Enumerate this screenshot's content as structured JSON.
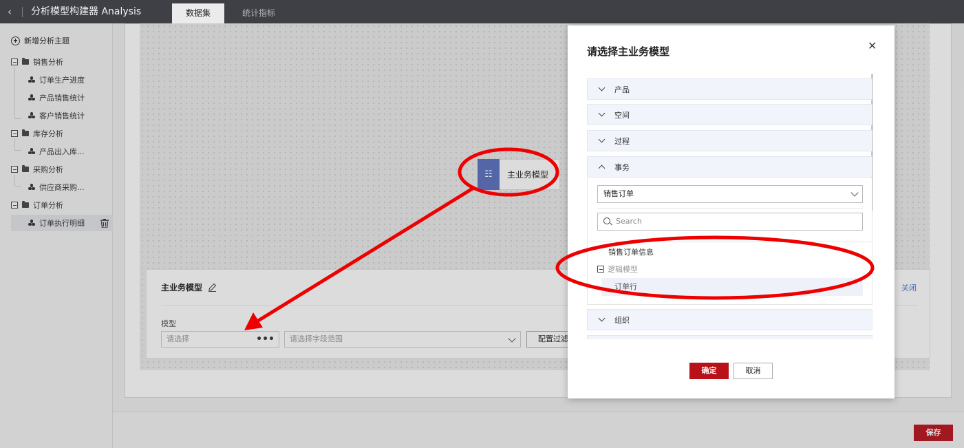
{
  "header": {
    "back_icon": "chevron-left-icon",
    "title": "分析模型构建器 Analysis",
    "tabs": [
      {
        "label": "数据集",
        "active": true
      },
      {
        "label": "统计指标",
        "active": false
      }
    ]
  },
  "sidebar": {
    "add_label": "新增分析主题",
    "groups": [
      {
        "label": "销售分析",
        "items": [
          "订单生产进度",
          "产品销售统计",
          "客户销售统计"
        ]
      },
      {
        "label": "库存分析",
        "items": [
          "产品出入库..."
        ]
      },
      {
        "label": "采购分析",
        "items": [
          "供应商采购..."
        ]
      },
      {
        "label": "订单分析",
        "items": [
          "订单执行明细"
        ]
      }
    ],
    "selected_item": "订单执行明细"
  },
  "canvas": {
    "node_label": "主业务模型",
    "node_icon": "model-icon"
  },
  "panel": {
    "title": "主业务模型",
    "close_label": "关闭",
    "model_label": "模型",
    "model_placeholder": "请选择",
    "range_placeholder": "请选择字段范围",
    "filter_label": "配置过滤"
  },
  "footer": {
    "save_label": "保存"
  },
  "modal": {
    "title": "请选择主业务模型",
    "sections": [
      "产品",
      "空间",
      "过程",
      "事务",
      "组织"
    ],
    "expanded_section": "事务",
    "select_value": "销售订单",
    "search_placeholder": "Search",
    "options": {
      "first": "销售订单信息",
      "group": "逻辑模型",
      "child": "订单行"
    },
    "ok_label": "确定",
    "cancel_label": "取消"
  },
  "colors": {
    "topbar": "#3e4046",
    "primary_red": "#b8111a",
    "node_blue": "#5b6fc0",
    "accordion_bg": "#f1f4fb",
    "annotation_red": "#ee0000",
    "link_blue": "#4a6dd6"
  }
}
